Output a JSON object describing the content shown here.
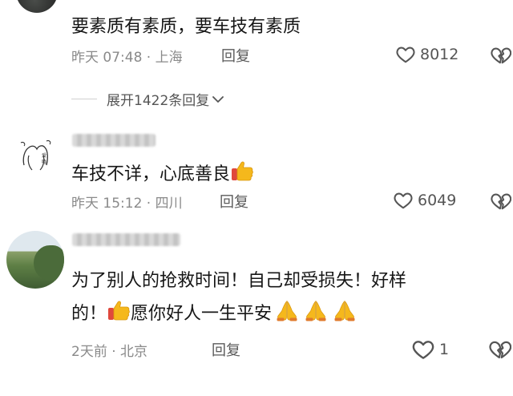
{
  "comments": [
    {
      "text": "要素质有素质，要车技有素质",
      "time": "昨天 07:48 · 上海",
      "reply": "回复",
      "likes": "8012"
    },
    {
      "text_before": "车技不详，心底善良",
      "emojis": [
        "thumbs-up"
      ],
      "time": "昨天 15:12 · 四川",
      "reply": "回复",
      "likes": "6049"
    },
    {
      "line1": "为了别人的抢救时间！自己却受损失！好样",
      "line2_prefix": "的！",
      "line2_text": "愿你好人一生平安",
      "emojis": [
        "thumbs-up",
        "praying-hands",
        "praying-hands",
        "praying-hands"
      ],
      "time": "2天前 · 北京",
      "reply": "回复",
      "likes": "1"
    }
  ],
  "expand_replies": "展开1422条回复",
  "colors": {
    "text": "#161616",
    "meta": "#8a8a8a",
    "emoji": "#f5b81c",
    "emoji_cuff": "#e0483c"
  }
}
